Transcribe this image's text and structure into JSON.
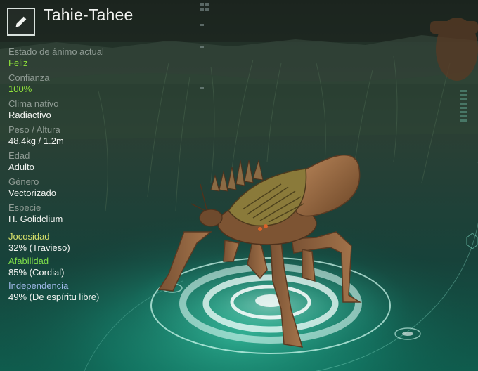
{
  "header": {
    "creature_name": "Tahie-Tahee",
    "edit_icon": "pencil-icon"
  },
  "stats": [
    {
      "label": "Estado de ánimo actual",
      "value": "Feliz",
      "value_color": "#8ee03a"
    },
    {
      "label": "Confianza",
      "value": "100%",
      "value_color": "#8ee03a"
    },
    {
      "label": "Clima nativo",
      "value": "Radiactivo",
      "value_color": "#f1f3f0"
    },
    {
      "label": "Peso / Altura",
      "value": "48.4kg / 1.2m",
      "value_color": "#f1f3f0"
    },
    {
      "label": "Edad",
      "value": "Adulto",
      "value_color": "#f1f3f0"
    },
    {
      "label": "Género",
      "value": "Vectorizado",
      "value_color": "#f1f3f0"
    },
    {
      "label": "Especie",
      "value": "H. Golidclium",
      "value_color": "#f1f3f0"
    }
  ],
  "traits": [
    {
      "label": "Jocosidad",
      "value": "32% (Travieso)",
      "label_color": "#d7e06a"
    },
    {
      "label": "Afabilidad",
      "value": "85% (Cordial)",
      "label_color": "#7fe04a"
    },
    {
      "label": "Independencia",
      "value": "49% (De espíritu libre)",
      "label_color": "#9fb8e8"
    }
  ],
  "colors": {
    "accent_green": "#8ee03a",
    "holo_teal": "#2fd8b0"
  }
}
